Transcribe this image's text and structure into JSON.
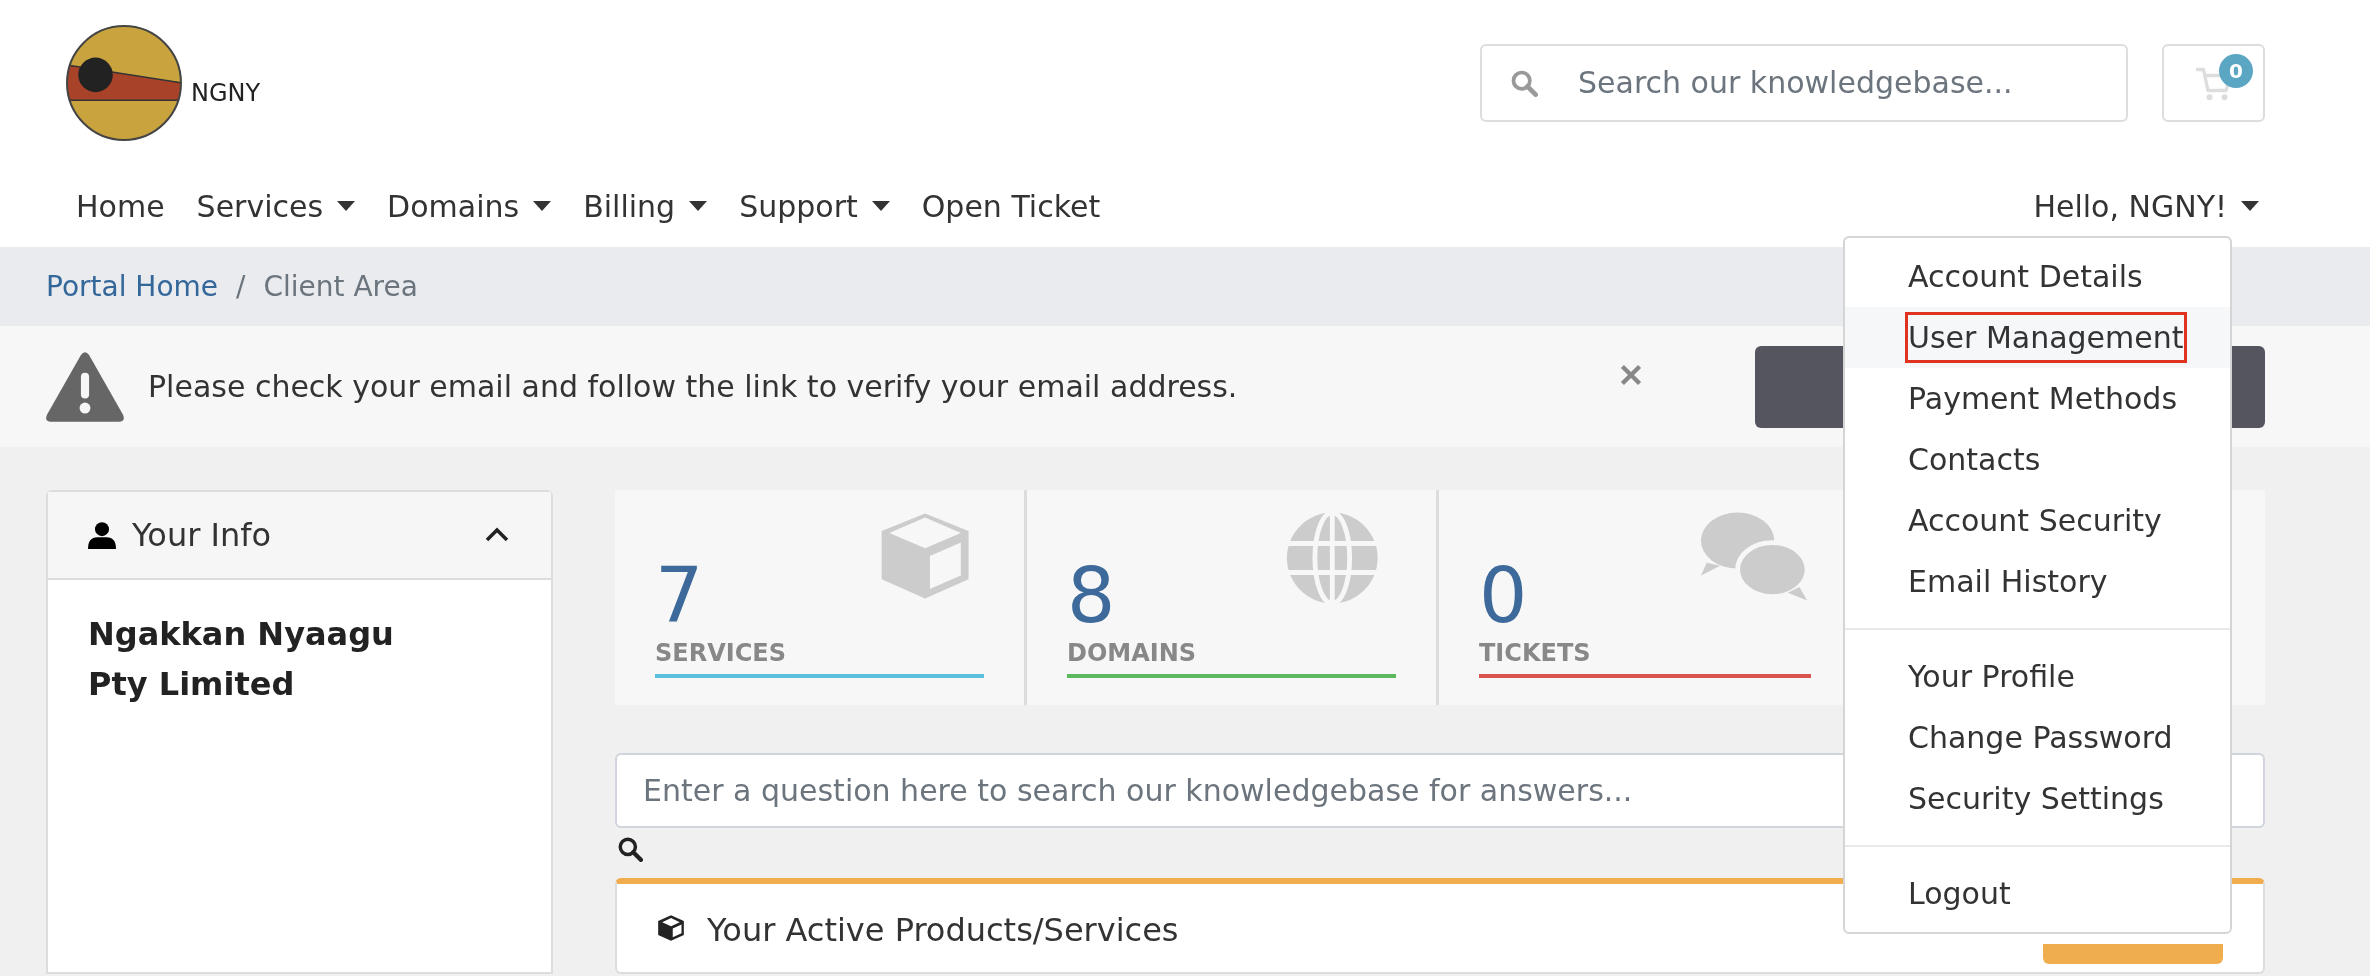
{
  "logo": {
    "text": "NGNY"
  },
  "header_search": {
    "placeholder": "Search our knowledgebase..."
  },
  "cart": {
    "count": "0"
  },
  "nav": {
    "items": [
      {
        "label": "Home",
        "has_menu": false
      },
      {
        "label": "Services",
        "has_menu": true
      },
      {
        "label": "Domains",
        "has_menu": true
      },
      {
        "label": "Billing",
        "has_menu": true
      },
      {
        "label": "Support",
        "has_menu": true
      },
      {
        "label": "Open Ticket",
        "has_menu": false
      }
    ],
    "user_menu": {
      "label": "Hello, NGNY!",
      "expanded": true
    }
  },
  "user_dropdown": {
    "sections": [
      {
        "items": [
          {
            "label": "Account Details",
            "selected": false
          },
          {
            "label": "User Management",
            "selected": true
          },
          {
            "label": "Payment Methods",
            "selected": false
          },
          {
            "label": "Contacts",
            "selected": false
          },
          {
            "label": "Account Security",
            "selected": false
          },
          {
            "label": "Email History",
            "selected": false
          }
        ]
      },
      {
        "items": [
          {
            "label": "Your Profile",
            "selected": false
          },
          {
            "label": "Change Password",
            "selected": false
          },
          {
            "label": "Security Settings",
            "selected": false
          }
        ]
      },
      {
        "items": [
          {
            "label": "Logout",
            "selected": false
          }
        ]
      }
    ]
  },
  "breadcrumb": {
    "separator": "/",
    "items": [
      {
        "label": "Portal Home",
        "link": true
      },
      {
        "label": "Client Area",
        "link": false
      }
    ]
  },
  "alert": {
    "message": "Please check your email and follow the link to verify your email address."
  },
  "sidebar": {
    "title": "Your Info",
    "expanded": true,
    "name": "Ngakkan Nyaagu Pty Limited"
  },
  "stats": [
    {
      "kind": "services",
      "count": "7",
      "label": "SERVICES",
      "color": "#5bc0de"
    },
    {
      "kind": "domains",
      "count": "8",
      "label": "DOMAINS",
      "color": "#5cb85c"
    },
    {
      "kind": "tickets",
      "count": "0",
      "label": "TICKETS",
      "color": "#d9534f"
    }
  ],
  "kb_search": {
    "placeholder": "Enter a question here to search our knowledgebase for answers..."
  },
  "products_panel": {
    "title": "Your Active Products/Services"
  }
}
